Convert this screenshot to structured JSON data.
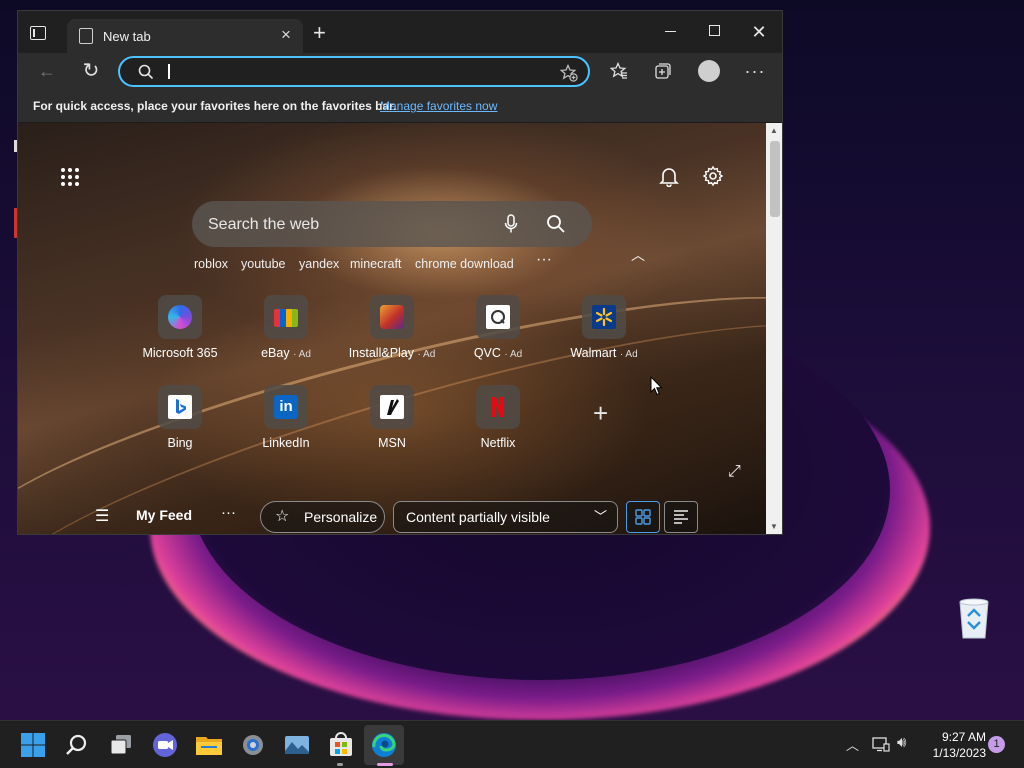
{
  "browser": {
    "tab_title": "New tab",
    "tab_close": "×",
    "new_tab": "+",
    "address_value": "",
    "favbar_text": "For quick access, place your favorites here on the favorites bar.",
    "favbar_link": "Manage favorites now"
  },
  "newtab": {
    "search_placeholder": "Search the web",
    "trending": [
      "roblox",
      "youtube",
      "yandex",
      "minecraft",
      "chrome download"
    ],
    "trending_more": "···",
    "tiles_row1": [
      {
        "label": "Microsoft 365",
        "ad": ""
      },
      {
        "label": "eBay",
        "ad": "· Ad"
      },
      {
        "label": "Install&Play",
        "ad": "· Ad"
      },
      {
        "label": "QVC",
        "ad": "· Ad"
      },
      {
        "label": "Walmart",
        "ad": "· Ad"
      }
    ],
    "tiles_row2": [
      {
        "label": "Bing"
      },
      {
        "label": "LinkedIn"
      },
      {
        "label": "MSN"
      },
      {
        "label": "Netflix"
      }
    ],
    "add_tile": "+"
  },
  "feed": {
    "title": "My Feed",
    "more": "···",
    "personalize": "Personalize",
    "visibility": "Content partially visible"
  },
  "taskbar": {
    "time": "9:27 AM",
    "date": "1/13/2023",
    "notifications": "1"
  },
  "colors": {
    "accent": "#4cc2ff",
    "link": "#6cb8ff",
    "taskbar": "#202020"
  }
}
